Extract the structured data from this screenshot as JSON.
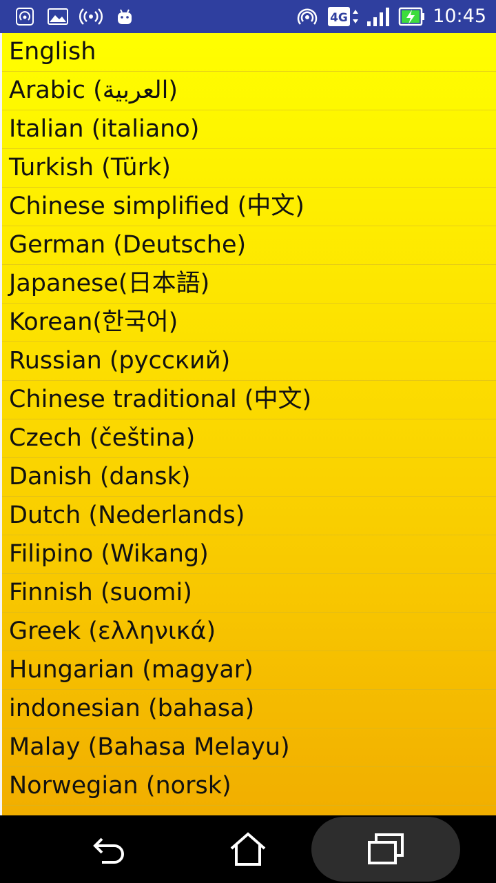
{
  "status_bar": {
    "time": "10:45",
    "network_type": "4G",
    "icons": [
      "hotspot-icon",
      "gallery-icon",
      "broadcast-icon",
      "android-icon",
      "wifi-hotspot-icon",
      "network-4g-icon",
      "signal-icon",
      "battery-charging-icon"
    ]
  },
  "languages": [
    "English",
    "Arabic (العربية)",
    "Italian (italiano)",
    "Turkish (Türk)",
    "Chinese simplified (中文)",
    "German (Deutsche)",
    "Japanese(日本語)",
    "Korean(한국어)",
    "Russian (русский)",
    "Chinese traditional (中文)",
    "Czech (čeština)",
    "Danish (dansk)",
    "Dutch (Nederlands)",
    "Filipino (Wikang)",
    "Finnish (suomi)",
    "Greek (ελληνικά)",
    "Hungarian (magyar)",
    "indonesian (bahasa)",
    "Malay (Bahasa Melayu)",
    "Norwegian (norsk)"
  ],
  "nav_bar": {
    "buttons": [
      "back-icon",
      "home-icon",
      "recents-icon"
    ]
  },
  "colors": {
    "status_bar_bg": "#2f3f9f",
    "list_gradient_top": "#ffff00",
    "list_gradient_bottom": "#f1ae00",
    "nav_bar_bg": "#000000"
  }
}
